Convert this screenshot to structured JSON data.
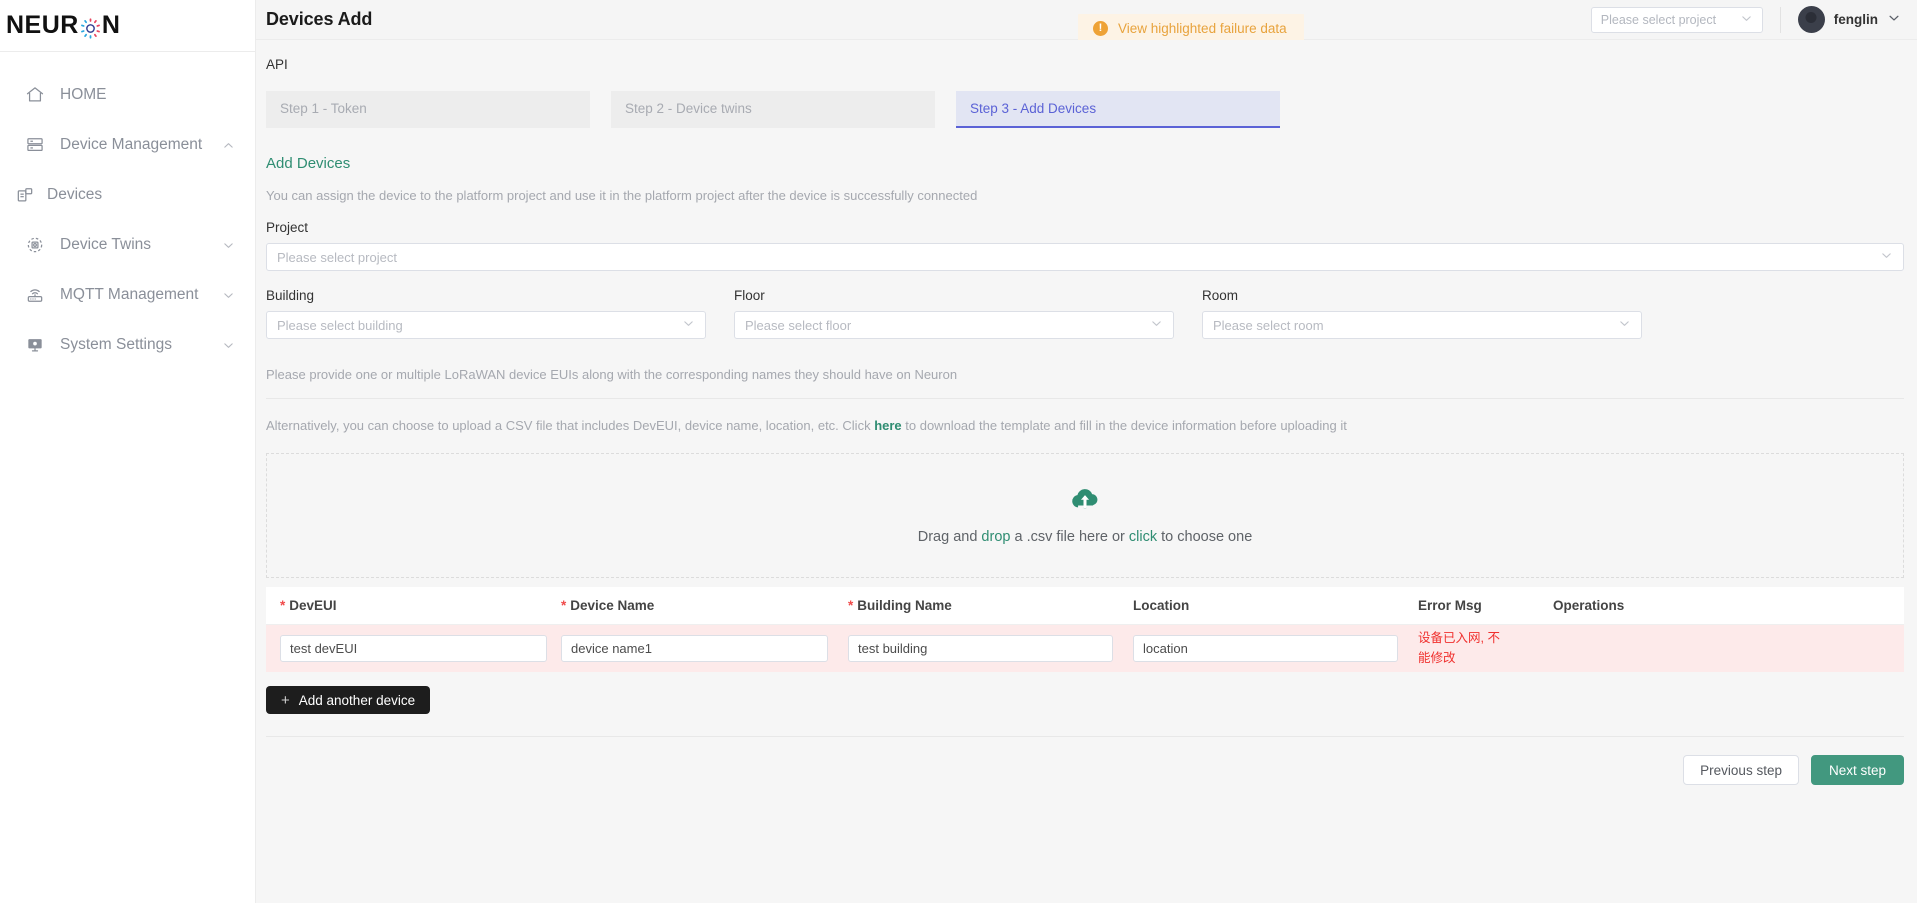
{
  "brand": {
    "logo_text_left": "NEUR",
    "logo_text_right": "N",
    "logo_icon": "gear-circle-icon",
    "accent_green": "#2f8d72",
    "accent_indigo": "#5b62d6",
    "accent_amber": "#eea236",
    "error_red": "#f0312f"
  },
  "sidebar": {
    "items": [
      {
        "label": "HOME",
        "icon": "home-icon",
        "arrow": "",
        "sub": false
      },
      {
        "label": "Device Management",
        "icon": "server-icon",
        "arrow": "chevron-up-icon",
        "sub": false
      },
      {
        "label": "Devices",
        "icon": "devices-icon",
        "arrow": "",
        "sub": true
      },
      {
        "label": "Device Twins",
        "icon": "twins-target-icon",
        "arrow": "chevron-down-icon",
        "sub": false
      },
      {
        "label": "MQTT Management",
        "icon": "router-signal-icon",
        "arrow": "chevron-down-icon",
        "sub": false
      },
      {
        "label": "System Settings",
        "icon": "monitor-icon",
        "arrow": "chevron-down-icon",
        "sub": false
      }
    ]
  },
  "topbar": {
    "page_title": "Devices Add",
    "alert": {
      "icon": "warning-exclamation-icon",
      "text": "View highlighted failure data"
    },
    "project_select": {
      "value": "Please select project",
      "caret": "chevron-down-icon"
    },
    "user": {
      "name": "fenglin",
      "avatar": "user-avatar",
      "caret": "chevron-down-icon"
    }
  },
  "main": {
    "api_label": "API",
    "steps": [
      {
        "label": "Step 1 - Token",
        "active": false
      },
      {
        "label": "Step 2 - Device twins",
        "active": false
      },
      {
        "label": "Step 3 - Add Devices",
        "active": true
      }
    ],
    "section_title": "Add Devices",
    "section_desc": "You can assign the device to the platform project and use it in the platform project after the device is successfully connected",
    "project": {
      "label": "Project",
      "placeholder": "Please select project"
    },
    "location_fields": [
      {
        "label": "Building",
        "placeholder": "Please select building"
      },
      {
        "label": "Floor",
        "placeholder": "Please select floor"
      },
      {
        "label": "Room",
        "placeholder": "Please select room"
      }
    ],
    "hint_1": "Please provide one or multiple LoRaWAN device EUIs along with the corresponding names they should have on Neuron",
    "hint_2_pre": "Alternatively, you can choose to upload a CSV file that includes DevEUI, device name, location, etc. Click ",
    "hint_2_link": "here",
    "hint_2_post": " to download the template and fill in the device information before uploading it",
    "dropzone": {
      "icon": "cloud-upload-icon",
      "text_pre": "Drag and ",
      "text_link_1": "drop",
      "text_mid": " a .csv file here or ",
      "text_link_2": "click",
      "text_post": " to choose one"
    },
    "table": {
      "columns": [
        {
          "label": "DevEUI",
          "required": true
        },
        {
          "label": "Device Name",
          "required": true
        },
        {
          "label": "Building Name",
          "required": true
        },
        {
          "label": "Location",
          "required": false
        },
        {
          "label": "Error Msg",
          "required": false
        },
        {
          "label": "Operations",
          "required": false
        }
      ],
      "rows": [
        {
          "devEUI": "test devEUI",
          "device_name": "device name1",
          "building_name": "test building",
          "location": "location",
          "error_msg": "设备已入网, 不能修改",
          "operations": ""
        }
      ]
    },
    "add_another_label": "Add another device",
    "add_another_icon": "plus-icon",
    "previous_step_label": "Previous step",
    "next_step_label": "Next step"
  }
}
